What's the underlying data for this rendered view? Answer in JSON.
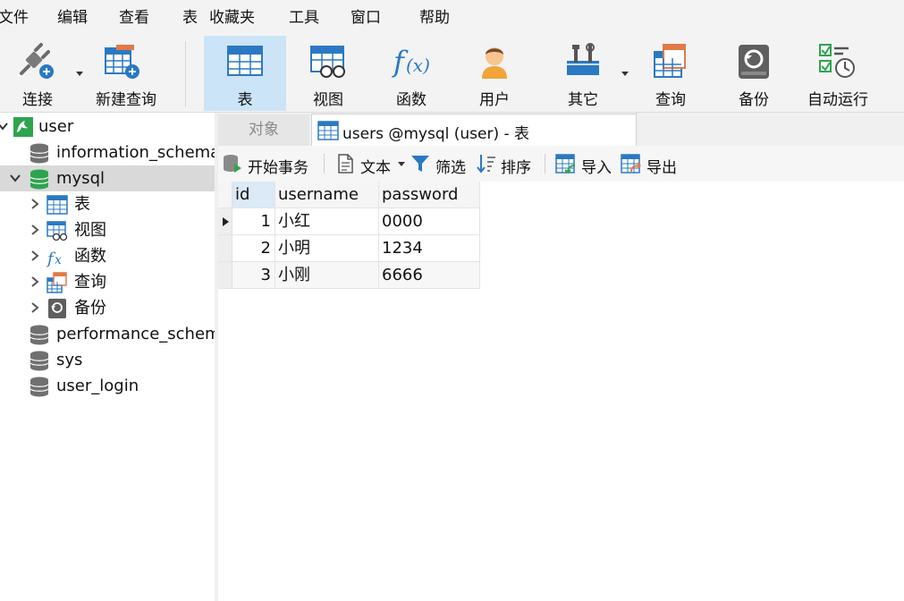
{
  "menu": [
    "文件",
    "编辑",
    "查看",
    "表",
    "收藏夹",
    "工具",
    "窗口",
    "帮助"
  ],
  "toolbar": {
    "connect": "连接",
    "new_query": "新建查询",
    "table": "表",
    "view": "视图",
    "function": "函数",
    "user": "用户",
    "other": "其它",
    "query": "查询",
    "backup": "备份",
    "auto_run": "自动运行"
  },
  "sidebar": {
    "connection": "user",
    "databases": [
      "information_schema",
      "mysql",
      "performance_schema",
      "sys",
      "user_login"
    ],
    "mysql_children": [
      "表",
      "视图",
      "函数",
      "查询",
      "备份"
    ]
  },
  "tabs": {
    "object": "对象",
    "users": "users @mysql (user) - 表"
  },
  "subtoolbar": {
    "begin_transaction": "开始事务",
    "text": "文本",
    "filter": "筛选",
    "sort": "排序",
    "import": "导入",
    "export": "导出"
  },
  "grid": {
    "columns": [
      "id",
      "username",
      "password"
    ],
    "rows": [
      [
        "1",
        "小红",
        "0000"
      ],
      [
        "2",
        "小明",
        "1234"
      ],
      [
        "3",
        "小刚",
        "6666"
      ]
    ]
  },
  "colors": {
    "accent_blue": "#2b79c2",
    "db_green": "#2ea44f",
    "selected_tab": "#cce4f7"
  }
}
